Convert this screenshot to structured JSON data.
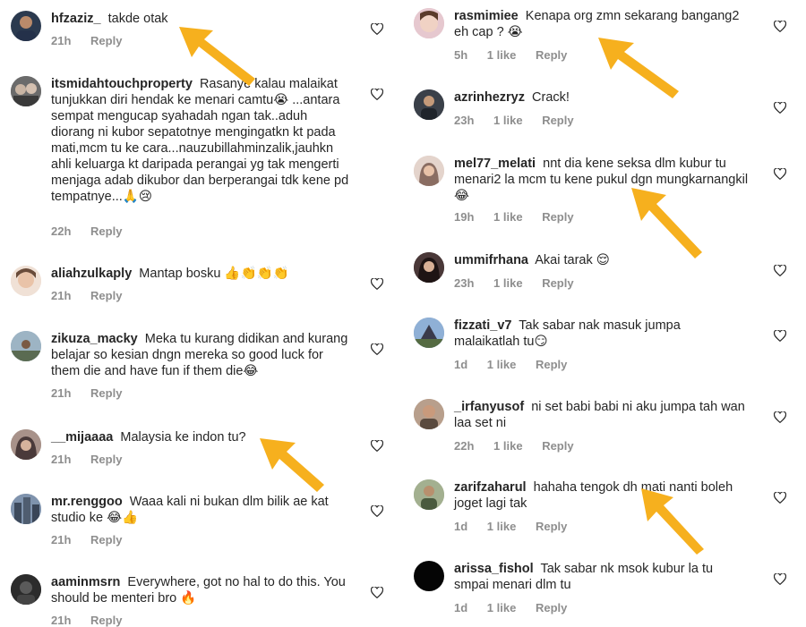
{
  "colors": {
    "text": "#262626",
    "meta": "#8e8e8e",
    "arrow": "#f6b01e"
  },
  "icons": {
    "like": "heart-outline-icon",
    "annotation": "yellow-arrow-icon"
  },
  "left_comments": [
    {
      "username": "hfzaziz_",
      "text": "takde otak",
      "time": "21h",
      "likes": "",
      "reply": "Reply"
    },
    {
      "username": "itsmidahtouchproperty",
      "text": "Rasanye kalau malaikat tunjukkan diri hendak ke menari camtu😭 ...antara sempat mengucap syahadah ngan tak..aduh diorang ni kubor sepatotnye mengingatkn kt pada mati,mcm tu ke cara...nauzubillahminzalik,jauhkn ahli keluarga kt daripada perangai yg tak mengerti menjaga adab dikubor dan berperangai tdk kene pd tempatnye...🙏😢",
      "time": "22h",
      "likes": "",
      "reply": "Reply"
    },
    {
      "username": "aliahzulkaply",
      "text": "Mantap bosku 👍👏👏👏",
      "time": "21h",
      "likes": "",
      "reply": "Reply"
    },
    {
      "username": "zikuza_macky",
      "text": "Meka tu kurang didikan and kurang belajar so kesian dngn mereka so good luck for them die and have fun if them die😂",
      "time": "21h",
      "likes": "",
      "reply": "Reply"
    },
    {
      "username": "__mijaaaa",
      "text": "Malaysia ke indon tu?",
      "time": "21h",
      "likes": "",
      "reply": "Reply"
    },
    {
      "username": "mr.renggoo",
      "text": "Waaa kali ni bukan dlm bilik ae kat studio ke 😂👍",
      "time": "21h",
      "likes": "",
      "reply": "Reply"
    },
    {
      "username": "aaminmsrn",
      "text": "Everywhere, got no hal to do this. You should be menteri bro 🔥",
      "time": "21h",
      "likes": "",
      "reply": "Reply"
    }
  ],
  "right_comments": [
    {
      "username": "rasmimiee",
      "text": "Kenapa org zmn sekarang bangang2 eh cap ? 😭",
      "time": "5h",
      "likes": "1 like",
      "reply": "Reply"
    },
    {
      "username": "azrinhezryz",
      "text": "Crack!",
      "time": "23h",
      "likes": "1 like",
      "reply": "Reply"
    },
    {
      "username": "mel77_melati",
      "text": "nnt dia kene seksa dlm kubur tu menari2 la mcm tu kene pukul dgn mungkarnangkil 😂",
      "time": "19h",
      "likes": "1 like",
      "reply": "Reply"
    },
    {
      "username": "ummifrhana",
      "text": "Akai tarak 😌",
      "time": "23h",
      "likes": "1 like",
      "reply": "Reply"
    },
    {
      "username": "fizzati_v7",
      "text": "Tak sabar nak masuk jumpa malaikatlah tu😏",
      "time": "1d",
      "likes": "1 like",
      "reply": "Reply"
    },
    {
      "username": "_irfanyusof",
      "text": "ni set babi babi ni aku jumpa tah wan laa set ni",
      "time": "22h",
      "likes": "1 like",
      "reply": "Reply"
    },
    {
      "username": "zarifzaharul",
      "text": "hahaha tengok dh mati nanti boleh joget lagi tak",
      "time": "1d",
      "likes": "1 like",
      "reply": "Reply"
    },
    {
      "username": "arissa_fishol",
      "text": "Tak sabar nk msok kubur la tu smpai menari dlm tu",
      "time": "1d",
      "likes": "1 like",
      "reply": "Reply"
    }
  ]
}
